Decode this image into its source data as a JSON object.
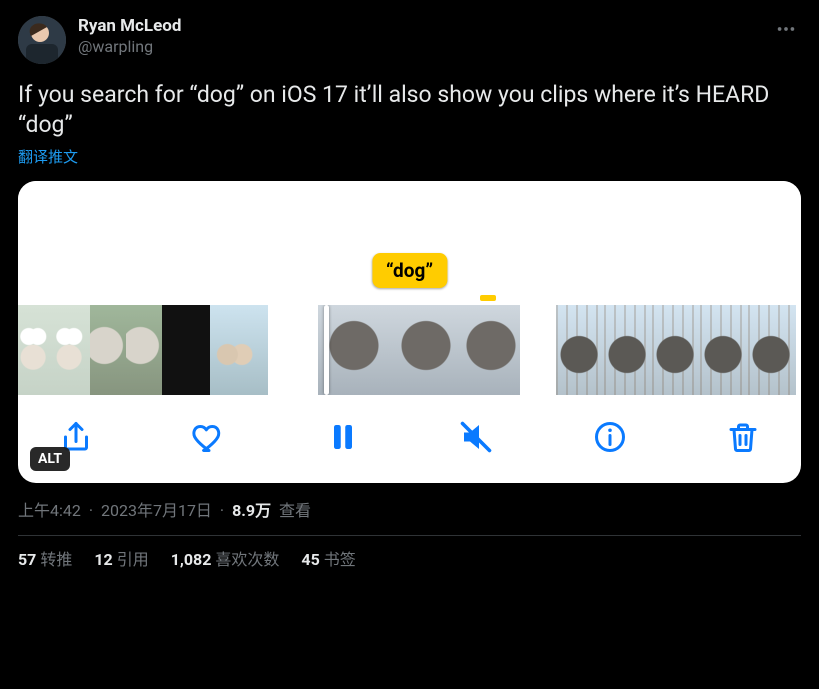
{
  "author": {
    "display_name": "Ryan McLeod",
    "handle": "@warpling"
  },
  "body_text": "If you search for “dog” on iOS 17 it’ll also show you clips where it’s HEARD “dog”",
  "translate_label": "翻译推文",
  "media": {
    "bubble": "“dog”",
    "alt_badge": "ALT",
    "toolbar": {
      "share": "share-icon",
      "like": "heart-icon",
      "pause": "pause-icon",
      "mute": "mute-icon",
      "info": "info-icon",
      "delete": "trash-icon"
    }
  },
  "meta": {
    "time": "上午4:42",
    "date": "2023年7月17日",
    "views_value": "8.9万",
    "views_label": "查看"
  },
  "stats": {
    "retweets": {
      "count": "57",
      "label": "转推"
    },
    "quotes": {
      "count": "12",
      "label": "引用"
    },
    "likes": {
      "count": "1,082",
      "label": "喜欢次数"
    },
    "bookmarks": {
      "count": "45",
      "label": "书签"
    }
  }
}
